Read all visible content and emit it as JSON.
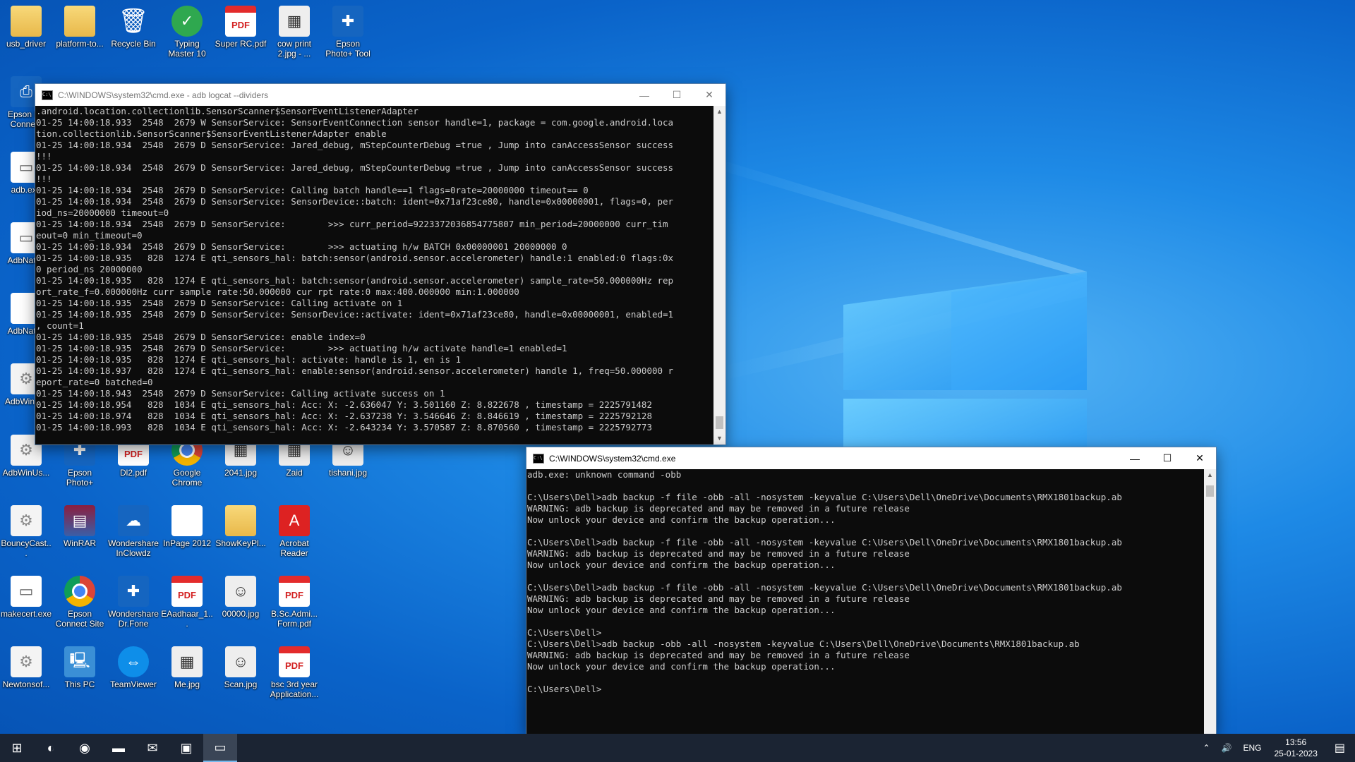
{
  "desktop_icons": [
    {
      "label": "usb_driver",
      "icon": "folder-icon",
      "kind": "folder",
      "glyph": ""
    },
    {
      "label": "platform-to...",
      "icon": "folder-icon",
      "kind": "folder",
      "glyph": ""
    },
    {
      "label": "Recycle Bin",
      "icon": "recycle-bin-icon",
      "kind": "recycle",
      "glyph": "🗑"
    },
    {
      "label": "Typing Master 10",
      "icon": "typing-master-icon",
      "kind": "green",
      "glyph": "✓"
    },
    {
      "label": "Super RC.pdf",
      "icon": "pdf-icon",
      "kind": "pdf",
      "glyph": "PDF"
    },
    {
      "label": "cow print 2.jpg - ...",
      "icon": "image-file-icon",
      "kind": "img",
      "glyph": "▦"
    },
    {
      "label": "Epson Photo+ Tool",
      "icon": "epson-photo-icon",
      "kind": "app",
      "glyph": "✚"
    },
    {
      "label": "Epson Pri Connect",
      "icon": "epson-print-icon",
      "kind": "app",
      "glyph": "⎙"
    },
    {
      "label": "adb.exe",
      "icon": "exe-icon",
      "kind": "doc",
      "glyph": "▭"
    },
    {
      "label": "AdbNati...",
      "icon": "exe-icon",
      "kind": "doc",
      "glyph": "▭"
    },
    {
      "label": "AdbNati...",
      "icon": "file-icon",
      "kind": "doc",
      "glyph": ""
    },
    {
      "label": "AdbWinA...",
      "icon": "gear-file-icon",
      "kind": "gear",
      "glyph": "⚙"
    },
    {
      "label": "AdbWinUs...",
      "icon": "gear-file-icon",
      "kind": "gear",
      "glyph": "⚙"
    },
    {
      "label": "Epson Photo+",
      "icon": "epson-photo-icon",
      "kind": "app",
      "glyph": "✚"
    },
    {
      "label": "Dl2.pdf",
      "icon": "pdf-icon",
      "kind": "pdf",
      "glyph": "PDF"
    },
    {
      "label": "Google Chrome",
      "icon": "chrome-icon",
      "kind": "chrome",
      "glyph": ""
    },
    {
      "label": "2041.jpg",
      "icon": "image-file-icon",
      "kind": "img",
      "glyph": "▦"
    },
    {
      "label": "Zaid",
      "icon": "image-file-icon",
      "kind": "img",
      "glyph": "▦"
    },
    {
      "label": "tishani.jpg",
      "icon": "photo-icon",
      "kind": "img",
      "glyph": "☺"
    },
    {
      "label": "BouncyCast...",
      "icon": "gear-file-icon",
      "kind": "gear",
      "glyph": "⚙"
    },
    {
      "label": "WinRAR",
      "icon": "winrar-icon",
      "kind": "rar",
      "glyph": "▤"
    },
    {
      "label": "Wondershare InClowdz",
      "icon": "wondershare-icon",
      "kind": "app",
      "glyph": "☁"
    },
    {
      "label": "InPage 2012",
      "icon": "file-icon",
      "kind": "doc",
      "glyph": ""
    },
    {
      "label": "ShowKeyPl...",
      "icon": "folder-icon",
      "kind": "folder",
      "glyph": ""
    },
    {
      "label": "Acrobat Reader",
      "icon": "acrobat-icon",
      "kind": "acro",
      "glyph": "A"
    },
    {
      "label": "makecert.exe",
      "icon": "exe-icon",
      "kind": "doc",
      "glyph": "▭"
    },
    {
      "label": "Epson Connect Site",
      "icon": "chrome-icon",
      "kind": "chrome",
      "glyph": ""
    },
    {
      "label": "Wondershare Dr.Fone",
      "icon": "drfone-icon",
      "kind": "app",
      "glyph": "✚"
    },
    {
      "label": "EAadhaar_1...",
      "icon": "pdf-icon",
      "kind": "pdf",
      "glyph": "PDF"
    },
    {
      "label": "00000.jpg",
      "icon": "photo-icon",
      "kind": "img",
      "glyph": "☺"
    },
    {
      "label": "B.Sc.Admi... Form.pdf",
      "icon": "pdf-icon",
      "kind": "pdf",
      "glyph": "PDF"
    },
    {
      "label": "Newtonsof...",
      "icon": "gear-file-icon",
      "kind": "gear",
      "glyph": "⚙"
    },
    {
      "label": "This PC",
      "icon": "this-pc-icon",
      "kind": "pc",
      "glyph": "🖳"
    },
    {
      "label": "TeamViewer",
      "icon": "teamviewer-icon",
      "kind": "tv",
      "glyph": "⇔"
    },
    {
      "label": "Me.jpg",
      "icon": "image-file-icon",
      "kind": "img",
      "glyph": "▦"
    },
    {
      "label": "Scan.jpg",
      "icon": "photo-icon",
      "kind": "img",
      "glyph": "☺"
    },
    {
      "label": "bsc 3rd year Application...",
      "icon": "pdf-icon",
      "kind": "pdf",
      "glyph": "PDF"
    }
  ],
  "window1": {
    "title": "C:\\WINDOWS\\system32\\cmd.exe - adb  logcat --dividers",
    "lines": [
      ".android.location.collectionlib.SensorScanner$SensorEventListenerAdapter",
      "01-25 14:00:18.933  2548  2679 W SensorService: SensorEventConnection sensor handle=1, package = com.google.android.loca",
      "tion.collectionlib.SensorScanner$SensorEventListenerAdapter enable",
      "01-25 14:00:18.934  2548  2679 D SensorService: Jared_debug, mStepCounterDebug =true , Jump into canAccessSensor success",
      "!!!",
      "01-25 14:00:18.934  2548  2679 D SensorService: Jared_debug, mStepCounterDebug =true , Jump into canAccessSensor success",
      "!!!",
      "01-25 14:00:18.934  2548  2679 D SensorService: Calling batch handle==1 flags=0rate=20000000 timeout== 0",
      "01-25 14:00:18.934  2548  2679 D SensorService: SensorDevice::batch: ident=0x71af23ce80, handle=0x00000001, flags=0, per",
      "iod_ns=20000000 timeout=0",
      "01-25 14:00:18.934  2548  2679 D SensorService:        >>> curr_period=9223372036854775807 min_period=20000000 curr_tim",
      "eout=0 min_timeout=0",
      "01-25 14:00:18.934  2548  2679 D SensorService:        >>> actuating h/w BATCH 0x00000001 20000000 0",
      "01-25 14:00:18.935   828  1274 E qti_sensors_hal: batch:sensor(android.sensor.accelerometer) handle:1 enabled:0 flags:0x",
      "0 period_ns 20000000",
      "01-25 14:00:18.935   828  1274 E qti_sensors_hal: batch:sensor(android.sensor.accelerometer) sample_rate=50.000000Hz rep",
      "ort_rate_f=0.000000Hz curr sample rate:50.000000 cur rpt rate:0 max:400.000000 min:1.000000",
      "01-25 14:00:18.935  2548  2679 D SensorService: Calling activate on 1",
      "01-25 14:00:18.935  2548  2679 D SensorService: SensorDevice::activate: ident=0x71af23ce80, handle=0x00000001, enabled=1",
      ", count=1",
      "01-25 14:00:18.935  2548  2679 D SensorService: enable index=0",
      "01-25 14:00:18.935  2548  2679 D SensorService:        >>> actuating h/w activate handle=1 enabled=1",
      "01-25 14:00:18.935   828  1274 E qti_sensors_hal: activate: handle is 1, en is 1",
      "01-25 14:00:18.937   828  1274 E qti_sensors_hal: enable:sensor(android.sensor.accelerometer) handle 1, freq=50.000000 r",
      "eport_rate=0 batched=0",
      "01-25 14:00:18.943  2548  2679 D SensorService: Calling activate success on 1",
      "01-25 14:00:18.954   828  1034 E qti_sensors_hal: Acc: X: -2.636047 Y: 3.501160 Z: 8.822678 , timestamp = 2225791482",
      "01-25 14:00:18.974   828  1034 E qti_sensors_hal: Acc: X: -2.637238 Y: 3.546646 Z: 8.846619 , timestamp = 2225792128",
      "01-25 14:00:18.993   828  1034 E qti_sensors_hal: Acc: X: -2.643234 Y: 3.570587 Z: 8.870560 , timestamp = 2225792773"
    ]
  },
  "window2": {
    "title": "C:\\WINDOWS\\system32\\cmd.exe",
    "lines": [
      "adb.exe: unknown command -obb",
      "",
      "C:\\Users\\Dell>adb backup -f file -obb -all -nosystem -keyvalue C:\\Users\\Dell\\OneDrive\\Documents\\RMX1801backup.ab",
      "WARNING: adb backup is deprecated and may be removed in a future release",
      "Now unlock your device and confirm the backup operation...",
      "",
      "C:\\Users\\Dell>adb backup -f file -obb -all -nosystem -keyvalue C:\\Users\\Dell\\OneDrive\\Documents\\RMX1801backup.ab",
      "WARNING: adb backup is deprecated and may be removed in a future release",
      "Now unlock your device and confirm the backup operation...",
      "",
      "C:\\Users\\Dell>adb backup -f file -obb -all -nosystem -keyvalue C:\\Users\\Dell\\OneDrive\\Documents\\RMX1801backup.ab",
      "WARNING: adb backup is deprecated and may be removed in a future release",
      "Now unlock your device and confirm the backup operation...",
      "",
      "C:\\Users\\Dell>",
      "C:\\Users\\Dell>adb backup -obb -all -nosystem -keyvalue C:\\Users\\Dell\\OneDrive\\Documents\\RMX1801backup.ab",
      "WARNING: adb backup is deprecated and may be removed in a future release",
      "Now unlock your device and confirm the backup operation...",
      "",
      "C:\\Users\\Dell>"
    ]
  },
  "window_buttons": {
    "minimize": "—",
    "maximize": "☐",
    "close": "✕"
  },
  "taskbar": {
    "items": [
      {
        "icon": "windows-start-icon",
        "glyph": "⊞"
      },
      {
        "icon": "edge-icon",
        "glyph": "◐"
      },
      {
        "icon": "chrome-icon",
        "glyph": "◉"
      },
      {
        "icon": "file-explorer-icon",
        "glyph": "▬"
      },
      {
        "icon": "mail-icon",
        "glyph": "✉"
      },
      {
        "icon": "store-icon",
        "glyph": "▣"
      },
      {
        "icon": "cmd-icon",
        "glyph": "▭"
      }
    ],
    "tray": {
      "chevron": "⌃",
      "volume": "🔊",
      "language": "ENG",
      "time": "13:56",
      "date": "25-01-2023",
      "notification": "▤"
    }
  }
}
